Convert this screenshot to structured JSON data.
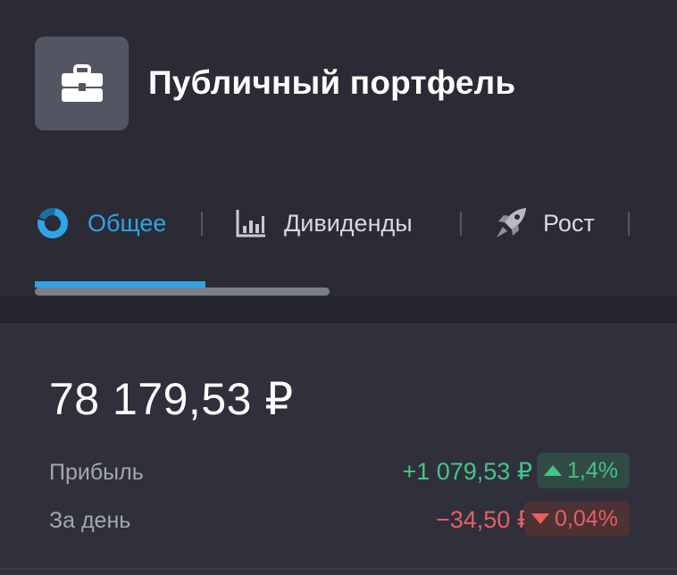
{
  "header": {
    "title": "Публичный портфель",
    "icon": "briefcase-icon"
  },
  "tabs": [
    {
      "label": "Общее",
      "icon": "donut-chart-icon",
      "active": true
    },
    {
      "label": "Дивиденды",
      "icon": "bar-chart-icon",
      "active": false
    },
    {
      "label": "Рост",
      "icon": "rocket-icon",
      "active": false
    }
  ],
  "summary": {
    "total_value": "78 179,53 ₽",
    "profit_label": "Прибыль",
    "profit_value": "+1 079,53 ₽",
    "profit_percent": "1,4%",
    "profit_direction": "up",
    "day_label": "За день",
    "day_value": "−34,50 ₽",
    "day_percent": "0,04%",
    "day_direction": "down"
  },
  "colors": {
    "accent": "#2fa3e6",
    "positive": "#45c486",
    "negative": "#e6605f",
    "background": "#2a2b35"
  }
}
